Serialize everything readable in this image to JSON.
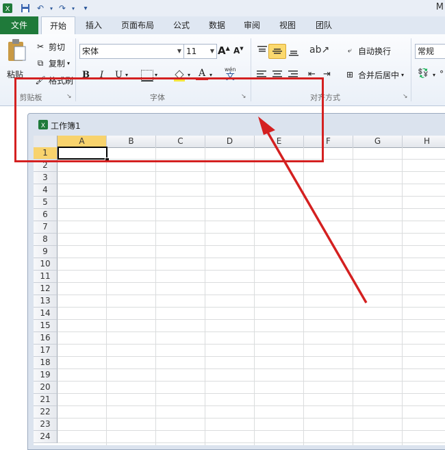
{
  "quick_access": {
    "app_icon": "excel-icon",
    "save_icon": "save-icon",
    "undo_icon": "undo-icon",
    "redo_icon": "redo-icon",
    "customize_icon": "customize-dropdown-icon"
  },
  "window": {
    "title_fragment": "M"
  },
  "tabs": [
    {
      "label": "文件"
    },
    {
      "label": "开始"
    },
    {
      "label": "插入"
    },
    {
      "label": "页面布局"
    },
    {
      "label": "公式"
    },
    {
      "label": "数据"
    },
    {
      "label": "审阅"
    },
    {
      "label": "视图"
    },
    {
      "label": "团队"
    }
  ],
  "clipboard": {
    "paste": "粘贴",
    "cut": "剪切",
    "copy": "复制",
    "format_painter": "格式刷",
    "group_label": "剪贴板"
  },
  "font": {
    "name": "宋体",
    "size": "11",
    "bold": "B",
    "italic": "I",
    "underline": "U",
    "font_color_letter": "A",
    "wen_letter": "wén",
    "wen_char": "文",
    "group_label": "字体"
  },
  "alignment": {
    "wrap_text": "自动换行",
    "merge_center": "合并后居中",
    "group_label": "对齐方式"
  },
  "number": {
    "format": "常规"
  },
  "workbook": {
    "title": "工作簿1"
  },
  "sheet": {
    "columns": [
      "A",
      "B",
      "C",
      "D",
      "E",
      "F",
      "G",
      "H"
    ],
    "rows": [
      "1",
      "2",
      "3",
      "4",
      "5",
      "6",
      "7",
      "8",
      "9",
      "10",
      "11",
      "12",
      "13",
      "14",
      "15",
      "16",
      "17",
      "18",
      "19",
      "20",
      "21",
      "22",
      "23",
      "24"
    ],
    "active_cell": "A1"
  },
  "colors": {
    "accent": "#1f7a3a",
    "selection": "#f8d36d",
    "annotation": "#d42020"
  }
}
